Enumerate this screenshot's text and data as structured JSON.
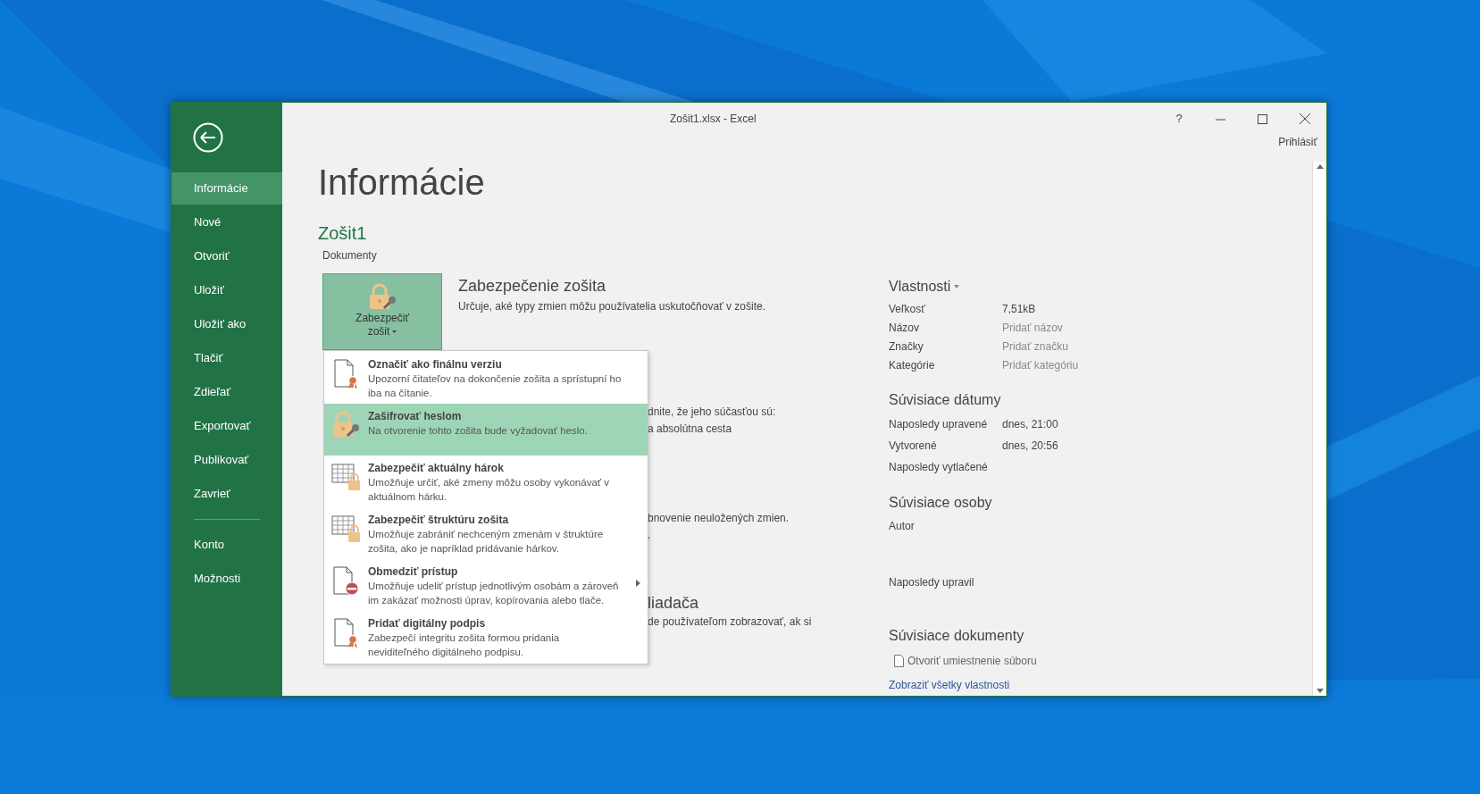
{
  "window": {
    "title": "Zošit1.xlsx - Excel",
    "help": "?",
    "sign_in": "Prihlásiť"
  },
  "sidebar": {
    "items": [
      {
        "label": "Informácie",
        "selected": true
      },
      {
        "label": "Nové",
        "selected": false
      },
      {
        "label": "Otvoriť",
        "selected": false
      },
      {
        "label": "Uložiť",
        "selected": false
      },
      {
        "label": "Uložiť ako",
        "selected": false
      },
      {
        "label": "Tlačiť",
        "selected": false
      },
      {
        "label": "Zdieľať",
        "selected": false
      },
      {
        "label": "Exportovať",
        "selected": false
      },
      {
        "label": "Publikovať",
        "selected": false
      },
      {
        "label": "Zavrieť",
        "selected": false
      }
    ],
    "bottom_items": [
      {
        "label": "Konto",
        "selected": false
      },
      {
        "label": "Možnosti",
        "selected": false
      }
    ]
  },
  "page": {
    "title": "Informácie",
    "file_name": "Zošit1",
    "location": "Dokumenty"
  },
  "protect": {
    "button_lines": [
      "Zabezpečiť",
      "zošit"
    ],
    "expanded": true,
    "heading": "Zabezpečenie zošita",
    "description": "Určuje, aké typy zmien môžu používatelia uskutočňovať v zošite."
  },
  "menu": [
    {
      "kind": "certificate",
      "title": "Označiť ako finálnu verziu",
      "description": "Upozorní čitateľov na dokončenie zošita a sprístupní ho iba na čítanie.",
      "selected": false,
      "submenu": false
    },
    {
      "kind": "lock-key",
      "title": "Zašifrovať heslom",
      "description": "Na otvorenie tohto zošita bude vyžadovať heslo.",
      "selected": true,
      "submenu": false
    },
    {
      "kind": "grid-lock",
      "title": "Zabezpečiť aktuálny hárok",
      "description": "Umožňuje určiť, aké zmeny môžu osoby vykonávať v aktuálnom hárku.",
      "selected": false,
      "submenu": false
    },
    {
      "kind": "grid-lock",
      "title": "Zabezpečiť štruktúru zošita",
      "description": "Umožňuje zabrániť nechceným zmenám v štruktúre zošita, ako je napríklad pridávanie hárkov.",
      "selected": false,
      "submenu": false
    },
    {
      "kind": "no-entry",
      "title": "Obmedziť prístup",
      "description": "Umožňuje udeliť prístup jednotlivým osobám a zároveň im zakázať možnosti úprav, kopírovania alebo tlače.",
      "selected": false,
      "submenu": true
    },
    {
      "kind": "certificate",
      "title": "Pridať digitálny podpis",
      "description": "Zabezpečí integritu zošita formou pridania neviditeľného digitálneho podpisu.",
      "selected": false,
      "submenu": false
    }
  ],
  "covered_fragments": [
    {
      "kind": "text",
      "text": "dnite, že jeho súčasťou sú:"
    },
    {
      "kind": "text",
      "text": "a absolútna cesta"
    },
    {
      "kind": "text",
      "text": "bnovenie neuložených zmien."
    },
    {
      "kind": "text",
      "text": "."
    },
    {
      "kind": "heading",
      "text": "liadača"
    },
    {
      "kind": "text",
      "text": "de používateľom zobrazovať, ak si"
    }
  ],
  "properties": {
    "heading": "Vlastnosti",
    "rows": [
      {
        "label": "Veľkosť",
        "value": "7,51kB",
        "placeholder": false
      },
      {
        "label": "Názov",
        "value": "Pridať názov",
        "placeholder": true
      },
      {
        "label": "Značky",
        "value": "Pridať značku",
        "placeholder": true
      },
      {
        "label": "Kategórie",
        "value": "Pridať kategóriu",
        "placeholder": true
      }
    ]
  },
  "dates": {
    "heading": "Súvisiace dátumy",
    "rows": [
      {
        "label": "Naposledy upravené",
        "value": "dnes, 21:00"
      },
      {
        "label": "Vytvorené",
        "value": "dnes, 20:56"
      },
      {
        "label": "Naposledy vytlačené"
      }
    ]
  },
  "people": {
    "heading": "Súvisiace osoby",
    "author_label": "Autor",
    "last_modified_label": "Naposledy upravil"
  },
  "documents": {
    "heading": "Súvisiace dokumenty",
    "open_location": "Otvoriť umiestnenie súboru",
    "show_all": "Zobraziť všetky vlastnosti"
  }
}
